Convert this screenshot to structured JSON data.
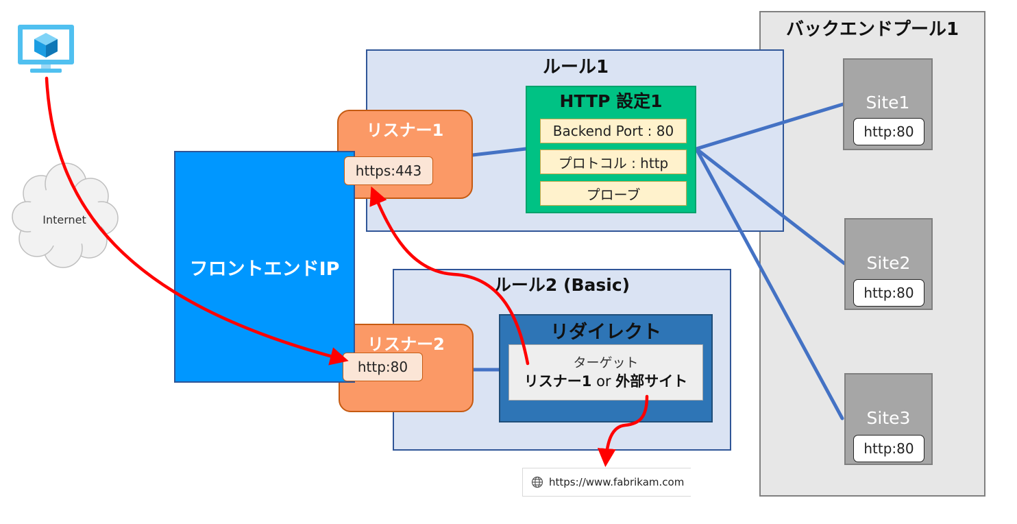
{
  "backend_pool": {
    "title": "バックエンドプール1"
  },
  "rule1": {
    "title": "ルール1"
  },
  "rule2": {
    "title": "ルール2 (Basic)"
  },
  "http_settings": {
    "title": "HTTP 設定1",
    "items": [
      "Backend Port : 80",
      "プロトコル : http",
      "プローブ"
    ]
  },
  "listener1": {
    "label": "リスナー1",
    "port": "https:443"
  },
  "listener2": {
    "label": "リスナー2",
    "port": "http:80"
  },
  "frontend": {
    "label": "フロントエンドIP"
  },
  "redirect": {
    "title": "リダイレクト",
    "target_label": "ターゲット",
    "target_part1": "リスナー1",
    "target_or": " or ",
    "target_part2": "外部サイト"
  },
  "sites": [
    {
      "name": "Site1",
      "port": "http:80"
    },
    {
      "name": "Site2",
      "port": "http:80"
    },
    {
      "name": "Site3",
      "port": "http:80"
    }
  ],
  "internet": {
    "label": "Internet"
  },
  "browser": {
    "url": "https://www.fabrikam.com"
  },
  "colors": {
    "request_arrow": "#ff0000",
    "connector": "#4472c4",
    "frontend": "#0097ff",
    "listener": "#fb9966",
    "http_settings": "#00c284",
    "redirect": "#2e75b6",
    "rule_background": "#dae3f3"
  }
}
